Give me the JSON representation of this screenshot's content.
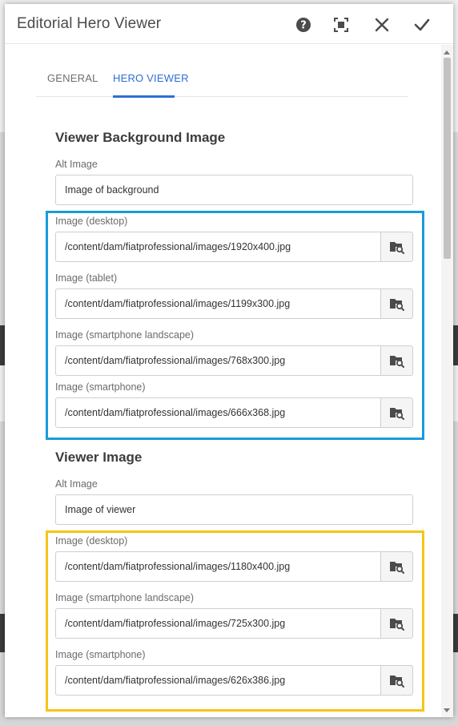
{
  "dialog": {
    "title": "Editorial Hero Viewer",
    "actions": {
      "help": "help-icon",
      "fullscreen": "fullscreen-icon",
      "close": "close-icon",
      "done": "check-icon"
    }
  },
  "tabs": [
    {
      "label": "GENERAL",
      "active": false
    },
    {
      "label": "HERO VIEWER",
      "active": true
    }
  ],
  "background_section": {
    "title": "Viewer Background Image",
    "alt_label": "Alt Image",
    "alt_value": "Image of background",
    "fields": [
      {
        "label": "Image (desktop)",
        "value": "/content/dam/fiatprofessional/images/1920x400.jpg"
      },
      {
        "label": "Image (tablet)",
        "value": "/content/dam/fiatprofessional/images/1199x300.jpg"
      },
      {
        "label": "Image (smartphone landscape)",
        "value": "/content/dam/fiatprofessional/images/768x300.jpg"
      },
      {
        "label": "Image (smartphone)",
        "value": "/content/dam/fiatprofessional/images/666x368.jpg"
      }
    ]
  },
  "viewer_section": {
    "title": "Viewer Image",
    "alt_label": "Alt Image",
    "alt_value": "Image of viewer",
    "fields": [
      {
        "label": "Image (desktop)",
        "value": "/content/dam/fiatprofessional/images/1180x400.jpg"
      },
      {
        "label": "Image (smartphone landscape)",
        "value": "/content/dam/fiatprofessional/images/725x300.jpg"
      },
      {
        "label": "Image (smartphone)",
        "value": "/content/dam/fiatprofessional/images/626x386.jpg"
      }
    ]
  },
  "icons": {
    "browse": "folder-search-icon"
  },
  "colors": {
    "accent": "#2e6fd1",
    "background_highlight": "#1a9bdc",
    "viewer_highlight": "#f5c518"
  }
}
